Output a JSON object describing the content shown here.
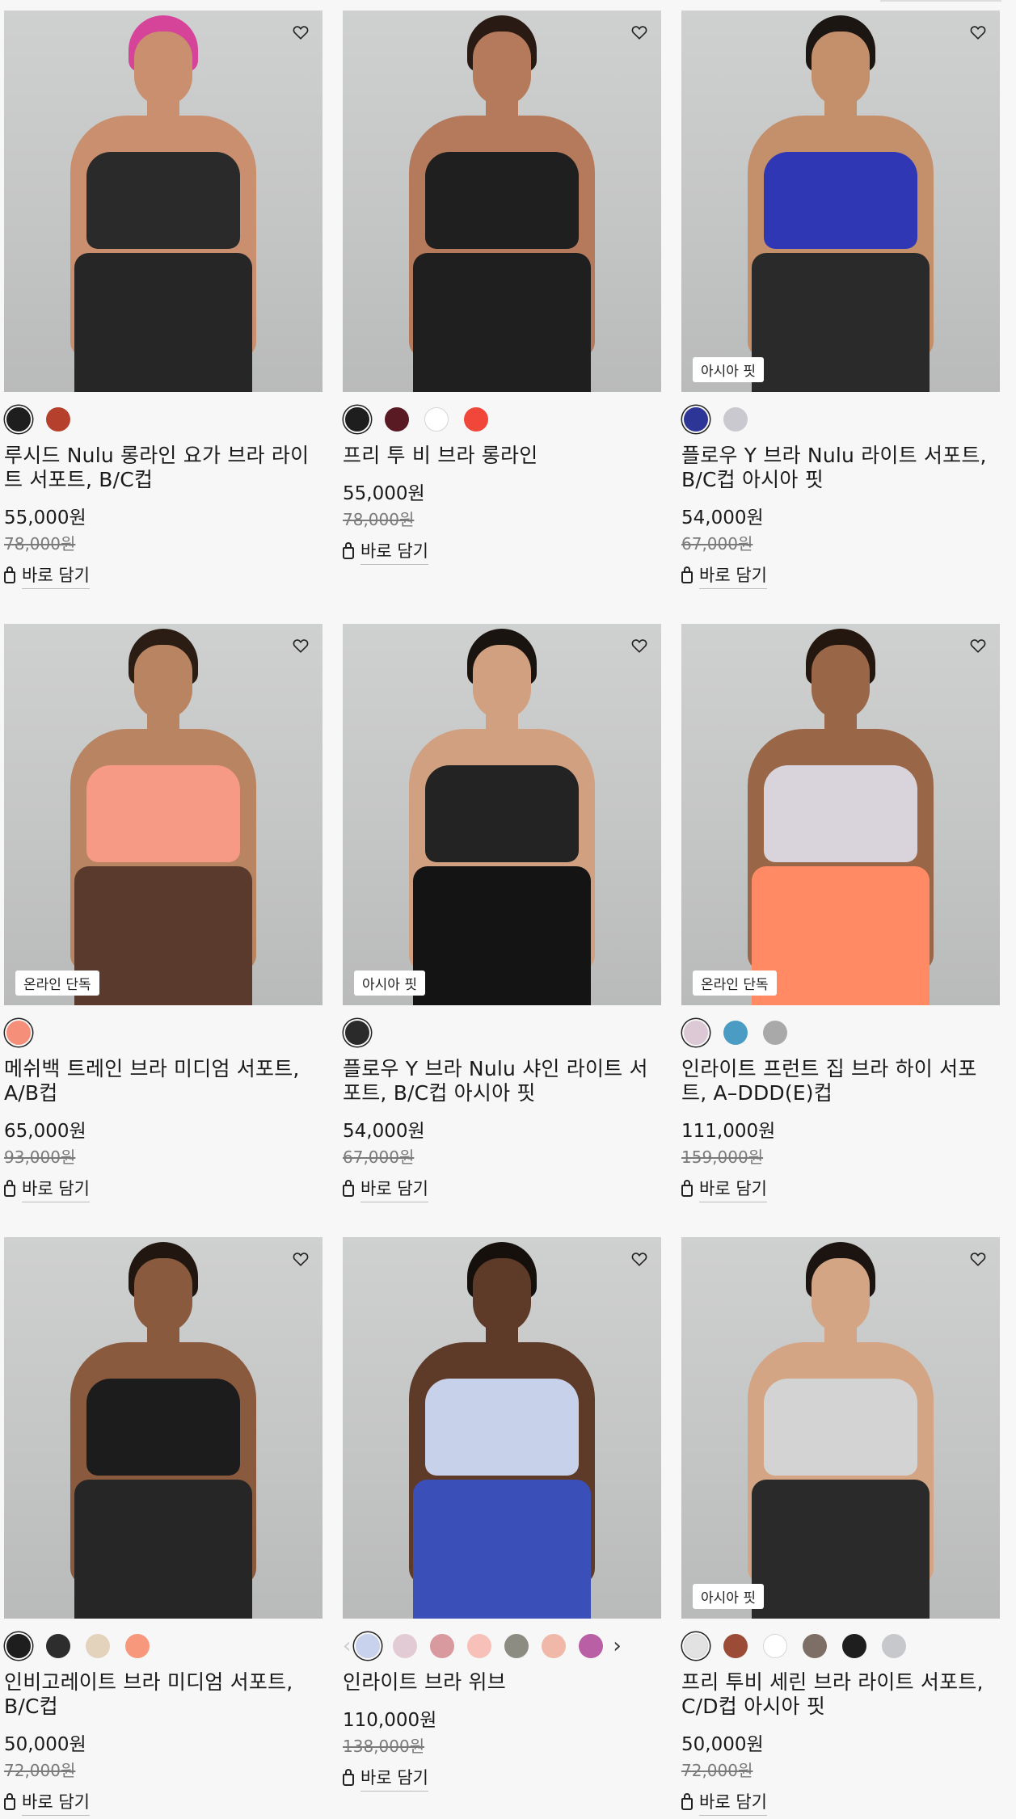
{
  "products": [
    {
      "name": "루시드 Nulu 롱라인 요가 브라 라이트 서포트, B/C컵",
      "price": "55,000원",
      "original_price": "78,000원",
      "badge": "",
      "cart_label": "바로 담기",
      "model": {
        "skin": "#c98f6e",
        "hair": "#d6449a",
        "top": "#2a2a2a",
        "bottom": "#262626"
      },
      "swatches": [
        "#1e1e1e",
        "#b5402c"
      ],
      "selected": 0,
      "has_arrows": false
    },
    {
      "name": "프리 투 비 브라 롱라인",
      "price": "55,000원",
      "original_price": "78,000원",
      "badge": "",
      "cart_label": "바로 담기",
      "model": {
        "skin": "#b57a5b",
        "hair": "#2a1a14",
        "top": "#1f1f1f",
        "bottom": "#1f1f1f"
      },
      "swatches": [
        "#1e1e1e",
        "#5a1a24",
        "#ffffff",
        "#f1473b"
      ],
      "selected": 0,
      "has_arrows": false
    },
    {
      "name": "플로우 Y 브라 Nulu 라이트 서포트, B/C컵 아시아 핏",
      "price": "54,000원",
      "original_price": "67,000원",
      "badge": "아시아 핏",
      "cart_label": "바로 담기",
      "model": {
        "skin": "#c4906c",
        "hair": "#1c1612",
        "top": "#3037b5",
        "bottom": "#2a2a2a"
      },
      "swatches": [
        "#2d3596",
        "#c9c9cf"
      ],
      "selected": 0,
      "has_arrows": false
    },
    {
      "name": "메쉬백 트레인 브라 미디엄 서포트, A/B컵",
      "price": "65,000원",
      "original_price": "93,000원",
      "badge": "온라인 단독",
      "cart_label": "바로 담기",
      "model": {
        "skin": "#b98462",
        "hair": "#2b1c14",
        "top": "#f79a85",
        "bottom": "#5a3a2c"
      },
      "swatches": [
        "#f58f7a"
      ],
      "selected": 0,
      "has_arrows": false
    },
    {
      "name": "플로우 Y 브라 Nulu 샤인 라이트 서포트, B/C컵 아시아 핏",
      "price": "54,000원",
      "original_price": "67,000원",
      "badge": "아시아 핏",
      "cart_label": "바로 담기",
      "model": {
        "skin": "#d0a080",
        "hair": "#1a1410",
        "top": "#232323",
        "bottom": "#141414"
      },
      "swatches": [
        "#2a2a2a"
      ],
      "selected": 0,
      "has_arrows": false
    },
    {
      "name": "인라이트 프런트 집 브라 하이 서포트, A–DDD(E)컵",
      "price": "111,000원",
      "original_price": "159,000원",
      "badge": "온라인 단독",
      "cart_label": "바로 담기",
      "model": {
        "skin": "#9a6648",
        "hair": "#24170f",
        "top": "#d9d4dc",
        "bottom": "#ff8a63"
      },
      "swatches": [
        "#ddc9d6",
        "#4a9cc4",
        "#a9a9a9"
      ],
      "selected": 0,
      "has_arrows": false
    },
    {
      "name": "인비고레이트 브라 미디엄 서포트, B/C컵",
      "price": "50,000원",
      "original_price": "72,000원",
      "badge": "",
      "cart_label": "바로 담기",
      "model": {
        "skin": "#8a5a3e",
        "hair": "#221610",
        "top": "#1c1c1c",
        "bottom": "#262626"
      },
      "swatches": [
        "#1e1e1e",
        "#2d2d2d",
        "#e3d3bd",
        "#f7977b"
      ],
      "selected": 0,
      "has_arrows": false
    },
    {
      "name": "인라이트 브라 위브",
      "price": "110,000원",
      "original_price": "138,000원",
      "badge": "",
      "cart_label": "바로 담기",
      "model": {
        "skin": "#5e3a28",
        "hair": "#15100c",
        "top": "#c7d1ea",
        "bottom": "#3a4fb8"
      },
      "swatches": [
        "#c8d2ec",
        "#e3cbd6",
        "#d99a9f",
        "#f7c0b9",
        "#8d8c82",
        "#efb8a8",
        "#b85fa5"
      ],
      "selected": 0,
      "has_arrows": true
    },
    {
      "name": "프리 투비 세린 브라 라이트 서포트, C/D컵 아시아 핏",
      "price": "50,000원",
      "original_price": "72,000원",
      "badge": "아시아 핏",
      "cart_label": "바로 담기",
      "model": {
        "skin": "#d4a585",
        "hair": "#1b1410",
        "top": "#d3d3d3",
        "bottom": "#2a2a2a"
      },
      "swatches": [
        "#e2e2e2",
        "#9c4c36",
        "#ffffff",
        "#7d6f66",
        "#1e1e1e",
        "#c7c8cc"
      ],
      "selected": 0,
      "has_arrows": false
    }
  ],
  "icons": {
    "wishlist": "heart-outline-icon",
    "cart": "shopping-bag-icon",
    "prev": "chevron-left-icon",
    "next": "chevron-right-icon"
  }
}
